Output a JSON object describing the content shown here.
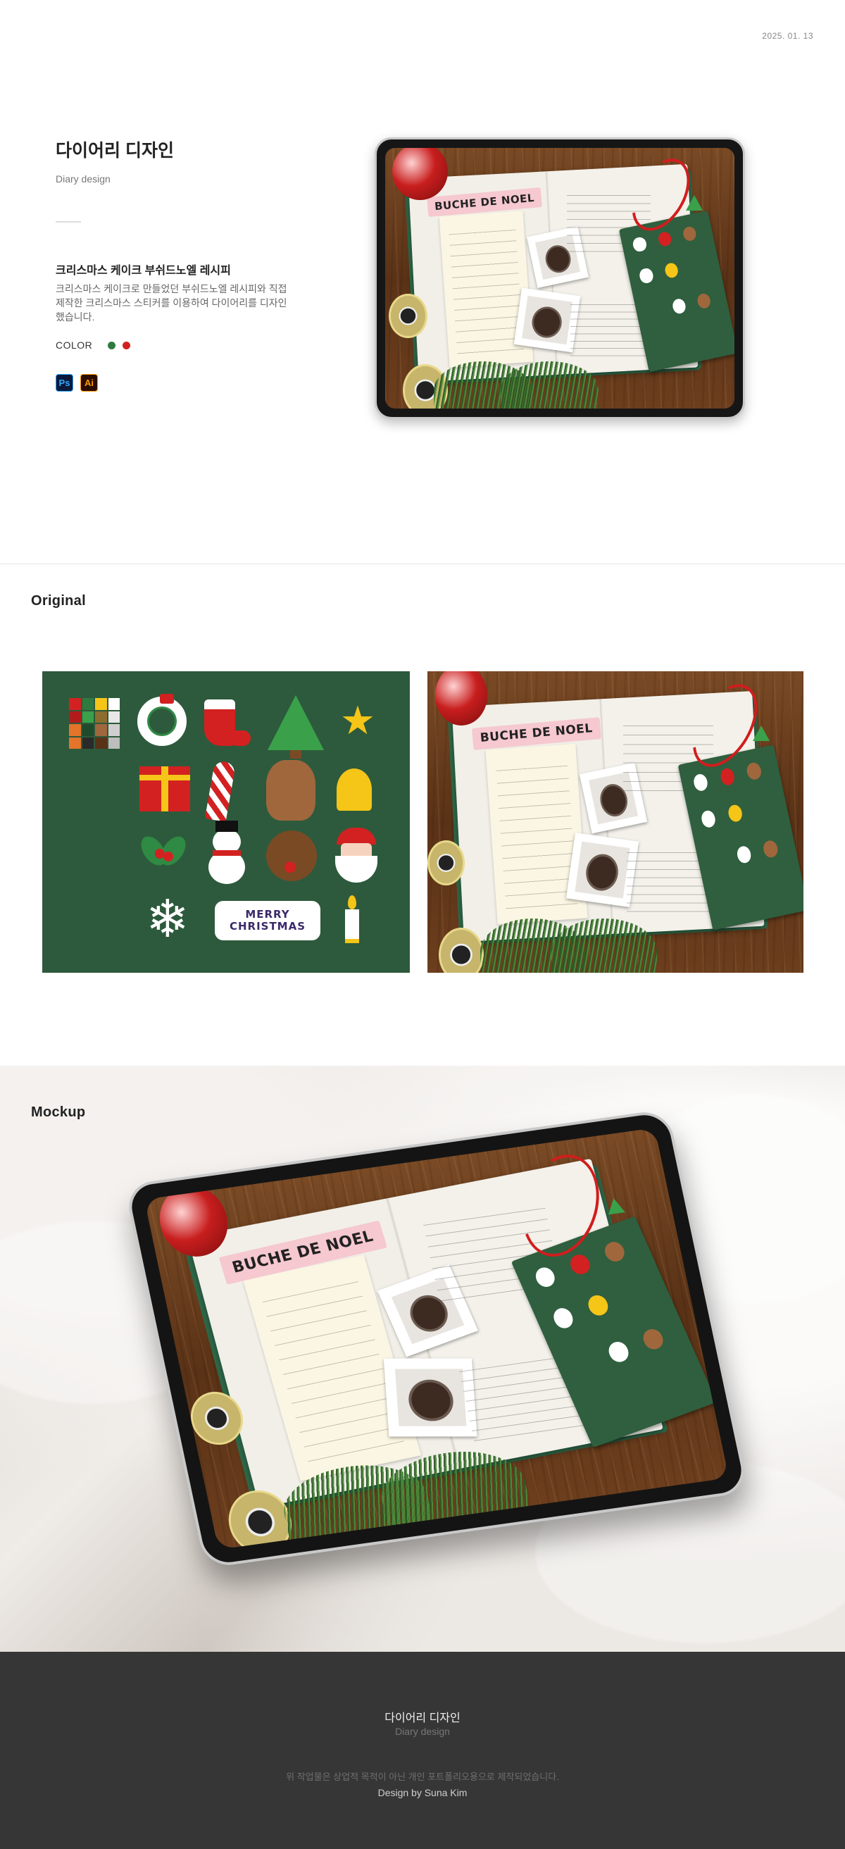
{
  "hero": {
    "date": "2025. 01. 13",
    "title": "다이어리 디자인",
    "subtitle": "Diary design",
    "project_title": "크리스마스 케이크 부쉬드노엘 레시피",
    "description": "크리스마스 케이크로 만들었던 부쉬드노엘 레시피와 직접 제작한 크리스마스 스티커를 이용하여 다이어리를 디자인 했습니다.",
    "color_label": "COLOR",
    "colors": [
      "#2f7a3f",
      "#d32121"
    ],
    "tools": [
      {
        "label": "Ps",
        "name": "photoshop-icon"
      },
      {
        "label": "Ai",
        "name": "illustrator-icon"
      }
    ]
  },
  "artwork": {
    "label": "BUCHE DE NOEL"
  },
  "original": {
    "label": "Original",
    "sticker_text_line1": "MERRY",
    "sticker_text_line2": "CHRISTMAS",
    "palette": [
      "#d32121",
      "#2f7a3f",
      "#f5c518",
      "#ffffff",
      "#b31b1b",
      "#3aa14a",
      "#8a6d2f",
      "#e8e8e8",
      "#e3742a",
      "#1f4a2c",
      "#a0673d",
      "#cfcfcf",
      "#e3742a",
      "#2a2a2a",
      "#5a3216",
      "#bdbdbd"
    ]
  },
  "mockup": {
    "label": "Mockup"
  },
  "footer": {
    "title": "다이어리 디자인",
    "subtitle": "Diary design",
    "note": "위 작업물은 상업적 목적이 아닌 개인 포트폴리오용으로 제작되었습니다.",
    "credit": "Design by Suna Kim"
  }
}
